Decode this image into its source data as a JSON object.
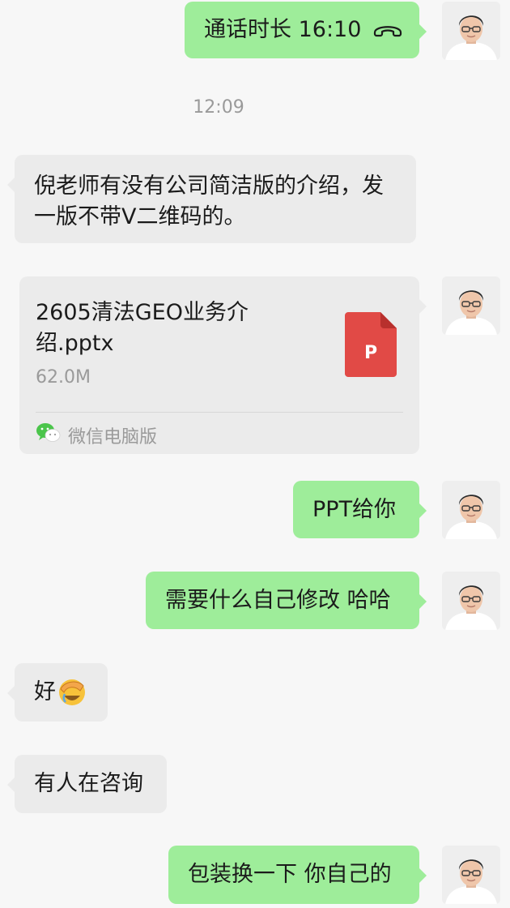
{
  "messages": {
    "call": {
      "text": "通话时长 16:10",
      "icon": "phone-hangup-icon"
    },
    "timestamp": "12:09",
    "incoming_1": {
      "text_line1": "倪老师有没有公司简洁版的介绍，发",
      "text_line2": "一版不带V二维码的。"
    },
    "file": {
      "name": "2605清法GEO业务介绍.pptx",
      "size": "62.0M",
      "type_letter": "P",
      "source": "微信电脑版",
      "icon": "ppt-file-icon",
      "source_icon": "wechat-icon"
    },
    "outgoing_1": {
      "text": "PPT给你"
    },
    "outgoing_2": {
      "text": "需要什么自己修改 哈哈"
    },
    "incoming_2": {
      "text": "好",
      "emoji": "facepalm-emoji"
    },
    "incoming_3": {
      "text": "有人在咨询"
    },
    "outgoing_3": {
      "text": "包装换一下 你自己的"
    }
  },
  "colors": {
    "outgoing_bubble": "#9eed9a",
    "incoming_bubble": "#ebebeb",
    "background": "#f7f7f7",
    "ppt_red": "#e14a46"
  }
}
